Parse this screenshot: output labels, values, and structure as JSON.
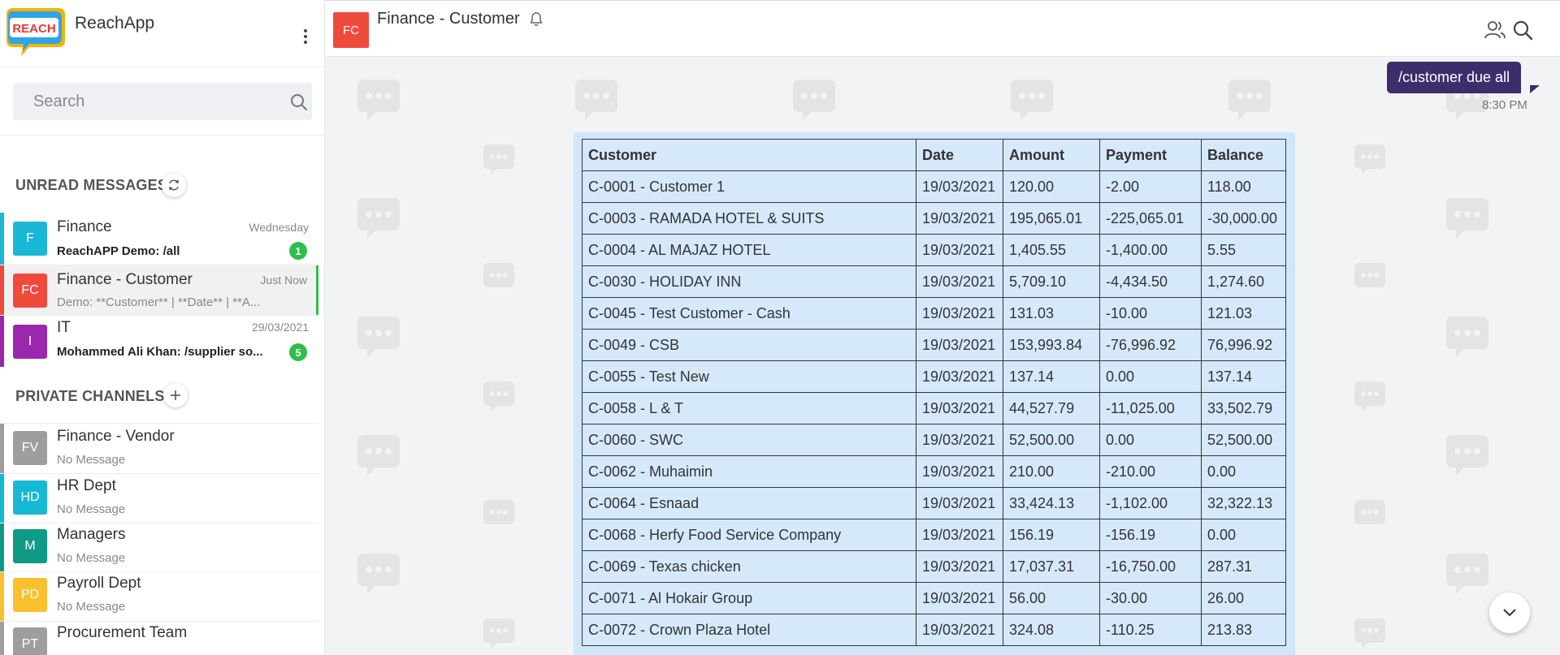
{
  "app": {
    "name": "ReachApp",
    "logo_text": "REACH"
  },
  "sidebar": {
    "search_placeholder": "Search",
    "unread_title": "UNREAD MESSAGES",
    "private_title": "PRIVATE CHANNELS",
    "unread": [
      {
        "initials": "F",
        "name": "Finance",
        "time": "Wednesday",
        "preview": "ReachAPP Demo: /all",
        "badge": "1",
        "color": "#1ab7d6"
      },
      {
        "initials": "FC",
        "name": "Finance - Customer",
        "time": "Just Now",
        "preview": "Demo: **Customer** | **Date** | **A...",
        "color": "#f04a3d"
      },
      {
        "initials": "I",
        "name": "IT",
        "time": "29/03/2021",
        "preview": "Mohammed Ali Khan: /supplier so...",
        "badge": "5",
        "color": "#9b27af"
      }
    ],
    "private": [
      {
        "initials": "FV",
        "name": "Finance - Vendor",
        "preview": "No Message",
        "color": "#9e9e9e"
      },
      {
        "initials": "HD",
        "name": "HR Dept",
        "preview": "No Message",
        "color": "#16b9d4"
      },
      {
        "initials": "M",
        "name": "Managers",
        "preview": "No Message",
        "color": "#0e9a84"
      },
      {
        "initials": "PD",
        "name": "Payroll Dept",
        "preview": "No Message",
        "color": "#fbc02d"
      },
      {
        "initials": "PT",
        "name": "Procurement Team",
        "preview": "",
        "color": "#9e9e9e"
      }
    ]
  },
  "chat": {
    "avatar": "FC",
    "title": "Finance - Customer",
    "outgoing_message": "/customer due all",
    "outgoing_time": "8:30 PM",
    "table": {
      "headers": [
        "Customer",
        "Date",
        "Amount",
        "Payment",
        "Balance"
      ],
      "rows": [
        [
          "C-0001 - Customer 1",
          "19/03/2021",
          "120.00",
          "-2.00",
          "118.00"
        ],
        [
          "C-0003 - RAMADA HOTEL & SUITS",
          "19/03/2021",
          "195,065.01",
          "-225,065.01",
          "-30,000.00"
        ],
        [
          "C-0004 - AL MAJAZ HOTEL",
          "19/03/2021",
          "1,405.55",
          "-1,400.00",
          "5.55"
        ],
        [
          "C-0030 - HOLIDAY INN",
          "19/03/2021",
          "5,709.10",
          "-4,434.50",
          "1,274.60"
        ],
        [
          "C-0045 - Test Customer - Cash",
          "19/03/2021",
          "131.03",
          "-10.00",
          "121.03"
        ],
        [
          "C-0049 - CSB",
          "19/03/2021",
          "153,993.84",
          "-76,996.92",
          "76,996.92"
        ],
        [
          "C-0055 - Test New",
          "19/03/2021",
          "137.14",
          "0.00",
          "137.14"
        ],
        [
          "C-0058 - L & T",
          "19/03/2021",
          "44,527.79",
          "-11,025.00",
          "33,502.79"
        ],
        [
          "C-0060 - SWC",
          "19/03/2021",
          "52,500.00",
          "0.00",
          "52,500.00"
        ],
        [
          "C-0062 - Muhaimin",
          "19/03/2021",
          "210.00",
          "-210.00",
          "0.00"
        ],
        [
          "C-0064 - Esnaad",
          "19/03/2021",
          "33,424.13",
          "-1,102.00",
          "32,322.13"
        ],
        [
          "C-0068 - Herfy Food Service Company",
          "19/03/2021",
          "156.19",
          "-156.19",
          "0.00"
        ],
        [
          "C-0069 - Texas chicken",
          "19/03/2021",
          "17,037.31",
          "-16,750.00",
          "287.31"
        ],
        [
          "C-0071 - Al Hokair Group",
          "19/03/2021",
          "56.00",
          "-30.00",
          "26.00"
        ],
        [
          "C-0072 - Crown Plaza Hotel",
          "19/03/2021",
          "324.08",
          "-110.25",
          "213.83"
        ]
      ]
    }
  },
  "colors": {
    "accent_green": "#2dbf4a",
    "outgoing_bubble": "#3d2d6b",
    "table_bg": "#d6e9fa"
  }
}
